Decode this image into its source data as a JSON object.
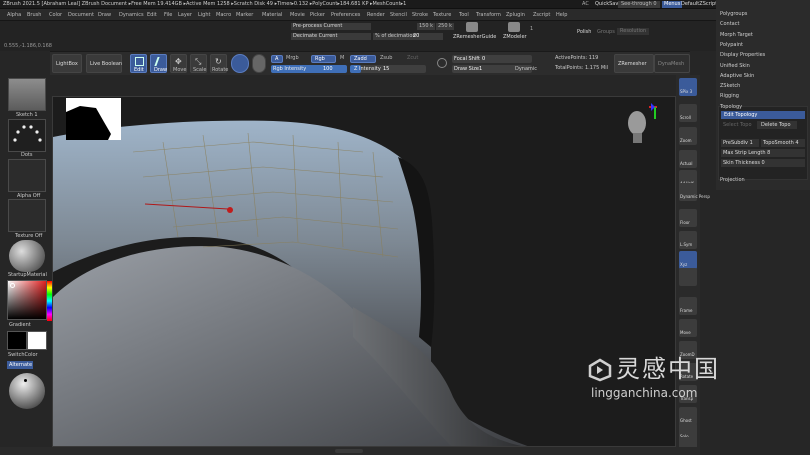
{
  "titlebar": {
    "title": "ZBrush 2021.5 [Abraham Leal]   ZBrush Document   ▸Free Mem 19.414GB ▸Active Mem 1258 ▸Scratch Disk 49 ▸Timer▸0.132 ▸PolyCount▸184.681 KP ▸MeshCount▸1",
    "ac": "AC",
    "quicksave": "QuickSave",
    "seethrough": "See-through  0",
    "menus": "Menus",
    "script": "DefaultZScript"
  },
  "menubar": [
    "Alpha",
    "Brush",
    "Color",
    "Document",
    "Draw",
    "Dynamics",
    "Edit",
    "File",
    "Layer",
    "Light",
    "Macro",
    "Marker",
    "Material",
    "Movie",
    "Picker",
    "Preferences",
    "Render",
    "Stencil",
    "Stroke",
    "Texture",
    "Tool",
    "Transform",
    "Zplugin",
    "Zscript",
    "Help"
  ],
  "infobar": {
    "coords": "0.555,-1.186,0.168",
    "preprocess": "Pre-process Current",
    "decimate": "Decimate Current",
    "pct_label": "% of decimation",
    "pct_value": "20",
    "k1": "150 k",
    "k2": "250 k",
    "zremesher": "ZRemesherGuide",
    "zmodeler": "ZModeler",
    "num1": "1",
    "polish": "Polish",
    "groups": "Groups",
    "resolution": "Resolution"
  },
  "toolbar": {
    "lightbox": "LightBox",
    "live_boolean": "Live Boolean",
    "edit": "Edit",
    "draw": "Draw",
    "move": "Move",
    "scale": "Scale",
    "rotate": "Rotate",
    "a": "A",
    "mrgb": "Mrgb",
    "rgb": "Rgb",
    "m": "M",
    "zadd": "Zadd",
    "zsub": "Zsub",
    "zcut": "Zcut",
    "rgb_intensity_label": "Rgb Intensity",
    "rgb_intensity_value": "100",
    "z_intensity_label": "Z Intensity",
    "z_intensity_value": "15",
    "rgb_intensity_level": 1.0,
    "z_intensity_level": 0.15,
    "focal_label": "Focal Shift",
    "focal_value": "0",
    "draw_size_label": "Draw Size",
    "draw_size_value": "1",
    "dynamic": "Dynamic",
    "active_points": "ActivePoints: 119",
    "total_points": "TotalPoints: 1.175 Mil",
    "zremesher": "ZRemesher",
    "dynamesh": "DynaMesh"
  },
  "leftshelf": {
    "brush": "Sketch 1",
    "stroke": "Dots",
    "alpha": "Alpha Off",
    "texture": "Texture Off",
    "material": "StartupMaterial",
    "gradient": "Gradient",
    "switch": "SwitchColor",
    "alternate": "Alternate"
  },
  "rightshelf": [
    "SPix 3",
    "Scroll",
    "Zoom",
    "Actual",
    "AAHalf",
    "Dynamic Persp",
    "Floor",
    "L.Sym",
    "Xyz",
    "",
    "Frame",
    "Move",
    "ZoomD",
    "Rotate",
    "Transp",
    "Ghost",
    "Solo",
    "Xpose"
  ],
  "rpanel": {
    "items_top": [
      "Polygroups",
      "Contact",
      "Morph Target",
      "Polypaint",
      "Display Properties",
      "Unified Skin",
      "Adaptive Skin",
      "ZSketch",
      "Rigging",
      "Topology"
    ],
    "edit_topology": "Edit Topology",
    "select_topo": "Select Topo",
    "delete_topo": "Delete Topo",
    "presubdiv": "PreSubdiv 1",
    "topo_smooth": "TopoSmooth 4",
    "max_strip": "Max Strip Length 8",
    "skin_thickness": "Skin Thickness 0",
    "projection": "Projection"
  },
  "watermark": {
    "cn": "灵感中国",
    "url": "lingganchina.com"
  },
  "colors": {
    "accent": "#3f6fb8",
    "bg": "#262626",
    "mesh": "#a9b4c0",
    "topology": "#8a7f5a"
  }
}
